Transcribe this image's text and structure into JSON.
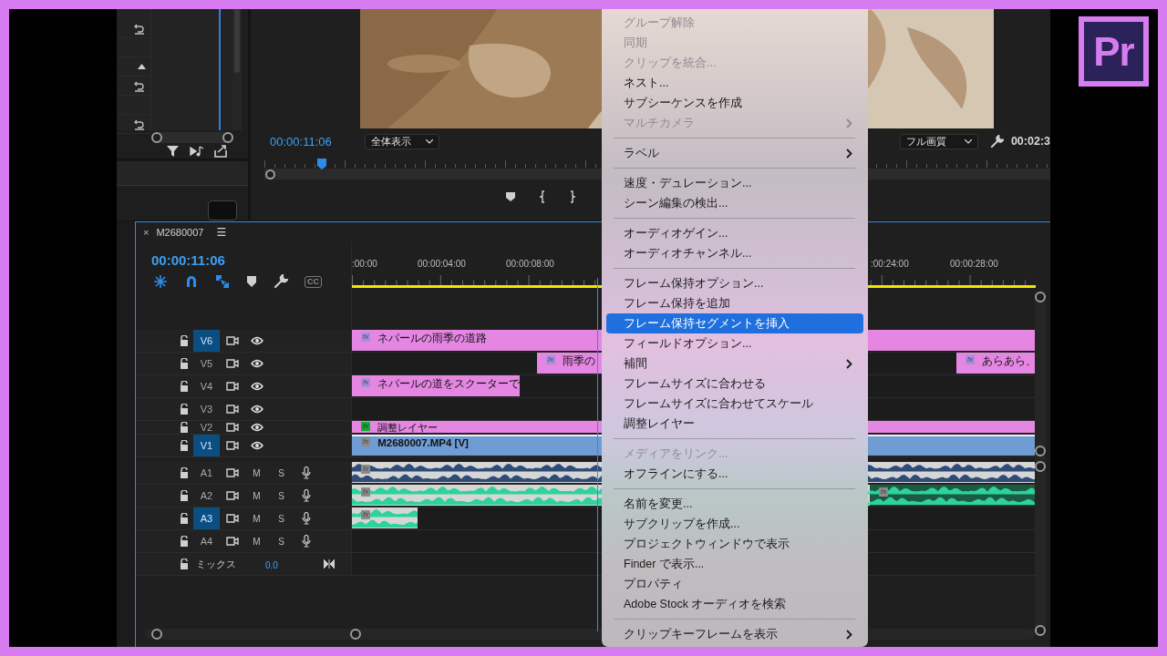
{
  "program_monitor": {
    "timecode": "00:00:11:06",
    "zoom_select": "全体表示",
    "quality_select": "フル画質",
    "duration": "00:02:3"
  },
  "timeline": {
    "close": "×",
    "sequence_name": "M2680007",
    "panel_menu": "☰",
    "timecode": "00:00:11:06",
    "captions_label": "CC",
    "ruler_labels": [
      ":00:00",
      "00:00:04:00",
      "00:00:08:00",
      ":00:24:00",
      "00:00:28:00"
    ],
    "tracks": [
      {
        "kind": "video",
        "label": "V6",
        "selected": true,
        "clips": [
          {
            "kind": "graphic",
            "badge": "fx",
            "name": "ネパールの雨季の道路",
            "color": "#e486e2"
          }
        ]
      },
      {
        "kind": "video",
        "label": "V5",
        "selected": false,
        "clips": [
          {
            "kind": "graphic",
            "badge": "fx",
            "name": "雨季の",
            "color": "#e486e2"
          },
          {
            "kind": "graphic",
            "badge": "fx",
            "name": "あらあら、",
            "color": "#e486e2"
          }
        ]
      },
      {
        "kind": "video",
        "label": "V4",
        "selected": false,
        "clips": [
          {
            "kind": "graphic",
            "badge": "fx",
            "name": "ネパールの道をスクーターで",
            "color": "#e486e2"
          }
        ]
      },
      {
        "kind": "video",
        "label": "V3",
        "selected": false
      },
      {
        "kind": "video",
        "label": "V2",
        "selected": false,
        "clips": [
          {
            "kind": "adjustment",
            "badge": "fx",
            "name": "調整レイヤー",
            "color": "#e486e2"
          }
        ]
      },
      {
        "kind": "video",
        "label": "V1",
        "selected": true,
        "clips": [
          {
            "kind": "media",
            "badge": "fx",
            "name": "M2680007.MP4 [V]",
            "color": "#6f9dd3"
          }
        ]
      },
      {
        "kind": "audio",
        "label": "A1",
        "selected": false,
        "mute": "M",
        "solo": "S",
        "clips": [
          {
            "kind": "audio",
            "badge": "fx",
            "color": "#2f4c78"
          }
        ]
      },
      {
        "kind": "audio",
        "label": "A2",
        "selected": false,
        "mute": "M",
        "solo": "S",
        "clips": [
          {
            "kind": "audio",
            "badge": "fx",
            "color": "#2ed39a"
          },
          {
            "kind": "audio",
            "badge": "fx",
            "color": "#2ed39a"
          }
        ]
      },
      {
        "kind": "audio",
        "label": "A3",
        "selected": true,
        "mute": "M",
        "solo": "S",
        "clips": [
          {
            "kind": "audio",
            "badge": "fx",
            "color": "#2ed39a"
          }
        ]
      },
      {
        "kind": "audio",
        "label": "A4",
        "selected": false,
        "mute": "M",
        "solo": "S"
      },
      {
        "kind": "mix",
        "label": "ミックス",
        "selected": false,
        "value": "0.0"
      }
    ]
  },
  "context_menu": {
    "items": [
      {
        "kind": "item",
        "label": "グループ解除",
        "disabled": true,
        "selected": false,
        "submenu": false
      },
      {
        "kind": "item",
        "label": "同期",
        "disabled": true,
        "selected": false,
        "submenu": false
      },
      {
        "kind": "item",
        "label": "クリップを統合...",
        "disabled": true,
        "selected": false,
        "submenu": false
      },
      {
        "kind": "item",
        "label": "ネスト...",
        "disabled": false,
        "selected": false,
        "submenu": false
      },
      {
        "kind": "item",
        "label": "サブシーケンスを作成",
        "disabled": false,
        "selected": false,
        "submenu": false
      },
      {
        "kind": "item",
        "label": "マルチカメラ",
        "disabled": true,
        "selected": false,
        "submenu": true
      },
      {
        "kind": "separator"
      },
      {
        "kind": "item",
        "label": "ラベル",
        "disabled": false,
        "selected": false,
        "submenu": true
      },
      {
        "kind": "separator"
      },
      {
        "kind": "item",
        "label": "速度・デュレーション...",
        "disabled": false,
        "selected": false,
        "submenu": false
      },
      {
        "kind": "item",
        "label": "シーン編集の検出...",
        "disabled": false,
        "selected": false,
        "submenu": false
      },
      {
        "kind": "separator"
      },
      {
        "kind": "item",
        "label": "オーディオゲイン...",
        "disabled": false,
        "selected": false,
        "submenu": false
      },
      {
        "kind": "item",
        "label": "オーディオチャンネル...",
        "disabled": false,
        "selected": false,
        "submenu": false
      },
      {
        "kind": "separator"
      },
      {
        "kind": "item",
        "label": "フレーム保持オプション...",
        "disabled": false,
        "selected": false,
        "submenu": false
      },
      {
        "kind": "item",
        "label": "フレーム保持を追加",
        "disabled": false,
        "selected": false,
        "submenu": false
      },
      {
        "kind": "item",
        "label": "フレーム保持セグメントを挿入",
        "disabled": false,
        "selected": true,
        "submenu": false
      },
      {
        "kind": "item",
        "label": "フィールドオプション...",
        "disabled": false,
        "selected": false,
        "submenu": false
      },
      {
        "kind": "item",
        "label": "補間",
        "disabled": false,
        "selected": false,
        "submenu": true
      },
      {
        "kind": "item",
        "label": "フレームサイズに合わせる",
        "disabled": false,
        "selected": false,
        "submenu": false
      },
      {
        "kind": "item",
        "label": "フレームサイズに合わせてスケール",
        "disabled": false,
        "selected": false,
        "submenu": false
      },
      {
        "kind": "item",
        "label": "調整レイヤー",
        "disabled": false,
        "selected": false,
        "submenu": false
      },
      {
        "kind": "separator"
      },
      {
        "kind": "item",
        "label": "メディアをリンク...",
        "disabled": true,
        "selected": false,
        "submenu": false
      },
      {
        "kind": "item",
        "label": "オフラインにする...",
        "disabled": false,
        "selected": false,
        "submenu": false
      },
      {
        "kind": "separator"
      },
      {
        "kind": "item",
        "label": "名前を変更...",
        "disabled": false,
        "selected": false,
        "submenu": false
      },
      {
        "kind": "item",
        "label": "サブクリップを作成...",
        "disabled": false,
        "selected": false,
        "submenu": false
      },
      {
        "kind": "item",
        "label": "プロジェクトウィンドウで表示",
        "disabled": false,
        "selected": false,
        "submenu": false
      },
      {
        "kind": "item",
        "label": "Finder で表示...",
        "disabled": false,
        "selected": false,
        "submenu": false
      },
      {
        "kind": "item",
        "label": "プロパティ",
        "disabled": false,
        "selected": false,
        "submenu": false
      },
      {
        "kind": "item",
        "label": "Adobe Stock オーディオを検索",
        "disabled": false,
        "selected": false,
        "submenu": false
      },
      {
        "kind": "separator"
      },
      {
        "kind": "item",
        "label": "クリップキーフレームを表示",
        "disabled": false,
        "selected": false,
        "submenu": true
      }
    ]
  },
  "logo": {
    "text": "Pr"
  }
}
